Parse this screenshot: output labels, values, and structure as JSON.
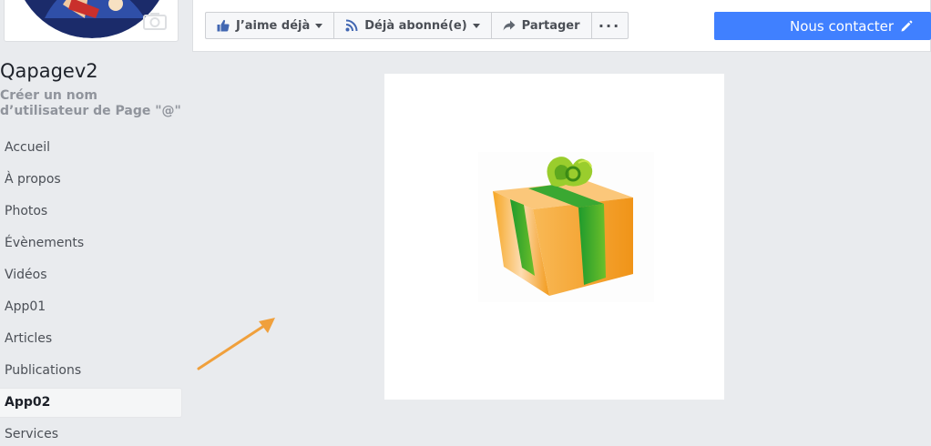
{
  "page": {
    "name": "Qapagev2",
    "username_prompt": "Créer un nom d’utilisateur de Page \"@\""
  },
  "nav": {
    "items": [
      {
        "label": "Accueil",
        "active": false
      },
      {
        "label": "À propos",
        "active": false
      },
      {
        "label": "Photos",
        "active": false
      },
      {
        "label": "Évènements",
        "active": false
      },
      {
        "label": "Vidéos",
        "active": false
      },
      {
        "label": "App01",
        "active": false
      },
      {
        "label": "Articles",
        "active": false
      },
      {
        "label": "Publications",
        "active": false
      },
      {
        "label": "App02",
        "active": true
      },
      {
        "label": "Services",
        "active": false
      }
    ]
  },
  "actions": {
    "like_label": "J’aime déjà",
    "follow_label": "Déjà abonné(e)",
    "share_label": "Partager",
    "more_label": "···",
    "contact_label": "Nous contacter"
  },
  "icons": {
    "like": "thumbs-up-icon",
    "follow": "rss-icon",
    "share": "share-arrow-icon",
    "contact": "pencil-icon",
    "camera": "camera-icon"
  },
  "colors": {
    "accent": "#4080ff",
    "like_blue": "#4267b2",
    "arrow_orange": "#f0a03c",
    "background": "#e9ebee"
  }
}
